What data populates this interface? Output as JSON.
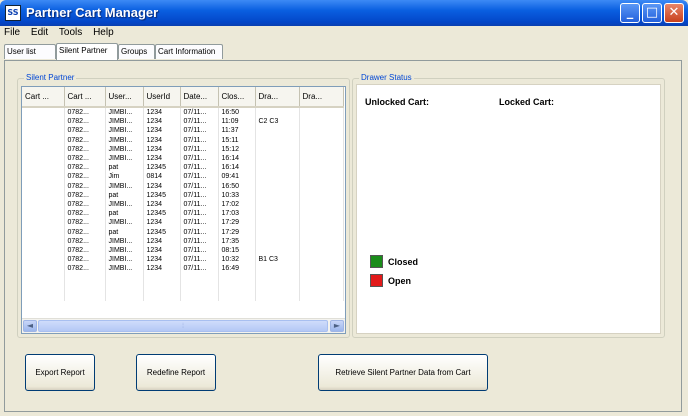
{
  "window": {
    "title": "Partner Cart Manager",
    "icon_text": "SS"
  },
  "menu": [
    "File",
    "Edit",
    "Tools",
    "Help"
  ],
  "tabs": [
    "User list",
    "Silent Partner",
    "Groups",
    "Cart Information"
  ],
  "silent_partner": {
    "group_label": "Silent Partner",
    "columns": [
      "Cart ...",
      "Cart ...",
      "User...",
      "UserId",
      "Date...",
      "Clos...",
      "Dra...",
      "Dra..."
    ],
    "rows": [
      [
        "",
        "0782...",
        "JIMBI...",
        "1234",
        "07/11...",
        "16:50",
        "",
        ""
      ],
      [
        "",
        "0782...",
        "JIMBI...",
        "1234",
        "07/11...",
        "11:09",
        "C2 C3",
        ""
      ],
      [
        "",
        "0782...",
        "JIMBI...",
        "1234",
        "07/11...",
        "11:37",
        "",
        ""
      ],
      [
        "",
        "0782...",
        "JIMBI...",
        "1234",
        "07/11...",
        "15:11",
        "",
        ""
      ],
      [
        "",
        "0782...",
        "JIMBI...",
        "1234",
        "07/11...",
        "15:12",
        "",
        ""
      ],
      [
        "",
        "0782...",
        "JIMBI...",
        "1234",
        "07/11...",
        "16:14",
        "",
        ""
      ],
      [
        "",
        "0782...",
        "pat",
        "12345",
        "07/11...",
        "16:14",
        "",
        ""
      ],
      [
        "",
        "0782...",
        "Jim",
        "0814",
        "07/11...",
        "09:41",
        "",
        ""
      ],
      [
        "",
        "0782...",
        "JIMBI...",
        "1234",
        "07/11...",
        "16:50",
        "",
        ""
      ],
      [
        "",
        "0782...",
        "pat",
        "12345",
        "07/11...",
        "10:33",
        "",
        ""
      ],
      [
        "",
        "0782...",
        "JIMBI...",
        "1234",
        "07/11...",
        "17:02",
        "",
        ""
      ],
      [
        "",
        "0782...",
        "pat",
        "12345",
        "07/11...",
        "17:03",
        "",
        ""
      ],
      [
        "",
        "0782...",
        "JIMBI...",
        "1234",
        "07/11...",
        "17:29",
        "",
        ""
      ],
      [
        "",
        "0782...",
        "pat",
        "12345",
        "07/11...",
        "17:29",
        "",
        ""
      ],
      [
        "",
        "0782...",
        "JIMBI...",
        "1234",
        "07/11...",
        "17:35",
        "",
        ""
      ],
      [
        "",
        "0782...",
        "JIMBI...",
        "1234",
        "07/11...",
        "08:15",
        "",
        ""
      ],
      [
        "",
        "0782...",
        "JIMBI...",
        "1234",
        "07/11...",
        "10:32",
        "B1 C3",
        ""
      ],
      [
        "",
        "0782...",
        "JIMBI...",
        "1234",
        "07/11...",
        "16:49",
        "",
        ""
      ]
    ],
    "scroll_thumb_glyph": "⦙",
    "scroll_left_glyph": "◄",
    "scroll_right_glyph": "►"
  },
  "drawer_status": {
    "group_label": "Drawer Status",
    "unlocked_label": "Unlocked Cart:",
    "locked_label": "Locked Cart:",
    "legend": [
      {
        "label": "Closed",
        "color": "#1a8c1a"
      },
      {
        "label": "Open",
        "color": "#e21a1a"
      }
    ]
  },
  "buttons": {
    "export": "Export Report",
    "redefine": "Redefine Report",
    "retrieve": "Retrieve Silent Partner Data from Cart"
  },
  "title_buttons": {
    "minimize": "_",
    "maximize": "□",
    "close": "✕"
  }
}
